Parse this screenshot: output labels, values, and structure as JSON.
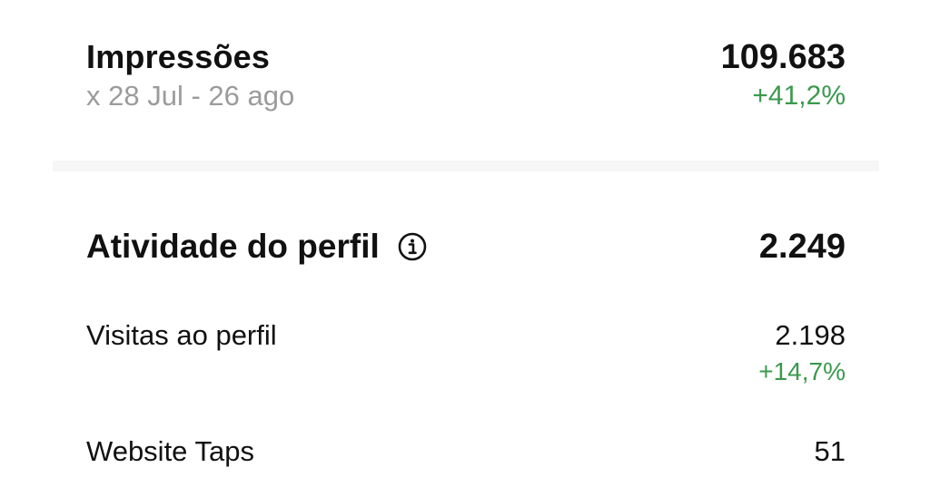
{
  "impressions": {
    "title": "Impressões",
    "date_range": "x 28 Jul - 26 ago",
    "value": "109.683",
    "change": "+41,2%"
  },
  "profile_activity": {
    "title": "Atividade do perfil",
    "info_icon": "info-circle-icon",
    "value": "2.249",
    "items": [
      {
        "label": "Visitas ao perfil",
        "value": "2.198",
        "change": "+14,7%"
      },
      {
        "label": "Website Taps",
        "value": "51"
      }
    ]
  },
  "colors": {
    "positive": "#3a9a4d",
    "muted": "#9b9b9b",
    "text": "#111111",
    "divider": "#f6f6f6"
  }
}
